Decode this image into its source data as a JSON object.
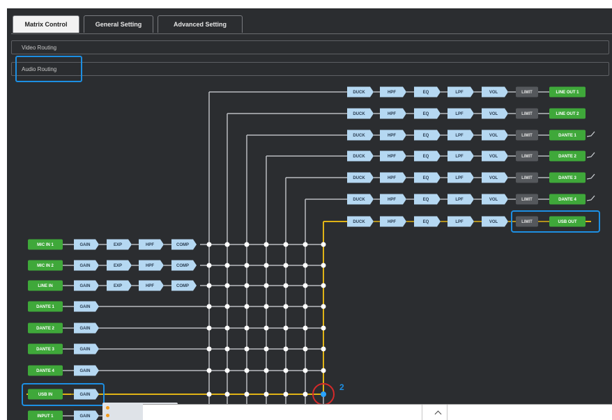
{
  "tabs": [
    {
      "label": "Matrix Control",
      "active": true
    },
    {
      "label": "General Setting",
      "active": false
    },
    {
      "label": "Advanced Setting",
      "active": false
    }
  ],
  "sections": {
    "video": "Video Routing",
    "audio": "Audio Routing"
  },
  "inputs": [
    {
      "label": "MIC IN 1",
      "chain": [
        "GAIN",
        "EXP",
        "HPF",
        "COMP"
      ]
    },
    {
      "label": "MIC IN 2",
      "chain": [
        "GAIN",
        "EXP",
        "HPF",
        "COMP"
      ]
    },
    {
      "label": "LINE IN",
      "chain": [
        "GAIN",
        "EXP",
        "HPF",
        "COMP"
      ]
    },
    {
      "label": "DANTE 1",
      "chain": [
        "GAIN"
      ]
    },
    {
      "label": "DANTE 2",
      "chain": [
        "GAIN"
      ]
    },
    {
      "label": "DANTE 3",
      "chain": [
        "GAIN"
      ]
    },
    {
      "label": "DANTE 4",
      "chain": [
        "GAIN"
      ]
    },
    {
      "label": "USB IN",
      "chain": [
        "GAIN"
      ]
    },
    {
      "label": "INPUT 1",
      "chain": [
        "GAIN"
      ]
    }
  ],
  "outputs": [
    {
      "label": "LINE OUT 1",
      "chain": [
        "DUCK",
        "HPF",
        "EQ",
        "LPF",
        "VOL",
        "LIMIT"
      ]
    },
    {
      "label": "LINE OUT 2",
      "chain": [
        "DUCK",
        "HPF",
        "EQ",
        "LPF",
        "VOL",
        "LIMIT"
      ]
    },
    {
      "label": "DANTE 1",
      "chain": [
        "DUCK",
        "HPF",
        "EQ",
        "LPF",
        "VOL",
        "LIMIT"
      ]
    },
    {
      "label": "DANTE 2",
      "chain": [
        "DUCK",
        "HPF",
        "EQ",
        "LPF",
        "VOL",
        "LIMIT"
      ]
    },
    {
      "label": "DANTE 3",
      "chain": [
        "DUCK",
        "HPF",
        "EQ",
        "LPF",
        "VOL",
        "LIMIT"
      ]
    },
    {
      "label": "DANTE 4",
      "chain": [
        "DUCK",
        "HPF",
        "EQ",
        "LPF",
        "VOL",
        "LIMIT"
      ]
    },
    {
      "label": "USB OUT",
      "chain": [
        "DUCK",
        "HPF",
        "EQ",
        "LPF",
        "VOL",
        "LIMIT"
      ]
    }
  ],
  "routing": {
    "active_input": "USB IN",
    "active_output": "USB OUT",
    "annotation_number": "2"
  },
  "colors": {
    "background": "#2b2d30",
    "io_node": "#3fa83a",
    "dsp_block": "#b5d8f2",
    "limit_block": "#55585c",
    "active_route": "#e0b316",
    "highlight": "#1d8fe3",
    "annotation_circle": "#d42a2a",
    "crosspoint": "#ffffff"
  }
}
